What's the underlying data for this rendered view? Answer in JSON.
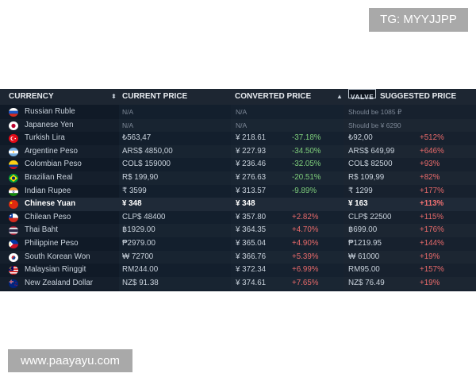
{
  "watermarks": {
    "top": "TG: MYYJJPP",
    "bottom": "www.paayayu.com"
  },
  "header": {
    "currency": "CURRENCY",
    "current_price": "CURRENT PRICE",
    "converted_price": "CONVERTED PRICE",
    "valve_logo": "VALVE",
    "suggested_price": "SUGGESTED PRICE",
    "sort_icon": "updown-arrows-icon",
    "sort_active_icon": "caret-up-icon"
  },
  "colors": {
    "negative": "#7fcf7c",
    "positive": "#e86a6a",
    "background": "#101a27"
  },
  "rows": [
    {
      "currency": "Russian Ruble",
      "flag": "russia-flag-icon",
      "current": "N/A",
      "converted": "N/A",
      "converted_pct": "",
      "suggested": "Should be 1085 ₽",
      "suggested_pct": ""
    },
    {
      "currency": "Japanese Yen",
      "flag": "japan-flag-icon",
      "current": "N/A",
      "converted": "N/A",
      "converted_pct": "",
      "suggested": "Should be ¥ 6290",
      "suggested_pct": ""
    },
    {
      "currency": "Turkish Lira",
      "flag": "turkey-flag-icon",
      "current": "₺563,47",
      "converted": "¥ 218.61",
      "converted_pct": "-37.18%",
      "suggested": "₺92,00",
      "suggested_pct": "+512%"
    },
    {
      "currency": "Argentine Peso",
      "flag": "argentina-flag-icon",
      "current": "ARS$ 4850,00",
      "converted": "¥ 227.93",
      "converted_pct": "-34.50%",
      "suggested": "ARS$ 649,99",
      "suggested_pct": "+646%"
    },
    {
      "currency": "Colombian Peso",
      "flag": "colombia-flag-icon",
      "current": "COL$ 159000",
      "converted": "¥ 236.46",
      "converted_pct": "-32.05%",
      "suggested": "COL$ 82500",
      "suggested_pct": "+93%"
    },
    {
      "currency": "Brazilian Real",
      "flag": "brazil-flag-icon",
      "current": "R$ 199,90",
      "converted": "¥ 276.63",
      "converted_pct": "-20.51%",
      "suggested": "R$ 109,99",
      "suggested_pct": "+82%"
    },
    {
      "currency": "Indian Rupee",
      "flag": "india-flag-icon",
      "current": "₹ 3599",
      "converted": "¥ 313.57",
      "converted_pct": "-9.89%",
      "suggested": "₹ 1299",
      "suggested_pct": "+177%"
    },
    {
      "currency": "Chinese Yuan",
      "flag": "china-flag-icon",
      "current": "¥ 348",
      "converted": "¥ 348",
      "converted_pct": "",
      "suggested": "¥ 163",
      "suggested_pct": "+113%"
    },
    {
      "currency": "Chilean Peso",
      "flag": "chile-flag-icon",
      "current": "CLP$ 48400",
      "converted": "¥ 357.80",
      "converted_pct": "+2.82%",
      "suggested": "CLP$ 22500",
      "suggested_pct": "+115%"
    },
    {
      "currency": "Thai Baht",
      "flag": "thailand-flag-icon",
      "current": "฿1929.00",
      "converted": "¥ 364.35",
      "converted_pct": "+4.70%",
      "suggested": "฿699.00",
      "suggested_pct": "+176%"
    },
    {
      "currency": "Philippine Peso",
      "flag": "philippines-flag-icon",
      "current": "₱2979.00",
      "converted": "¥ 365.04",
      "converted_pct": "+4.90%",
      "suggested": "₱1219.95",
      "suggested_pct": "+144%"
    },
    {
      "currency": "South Korean Won",
      "flag": "south-korea-flag-icon",
      "current": "₩ 72700",
      "converted": "¥ 366.76",
      "converted_pct": "+5.39%",
      "suggested": "₩ 61000",
      "suggested_pct": "+19%"
    },
    {
      "currency": "Malaysian Ringgit",
      "flag": "malaysia-flag-icon",
      "current": "RM244.00",
      "converted": "¥ 372.34",
      "converted_pct": "+6.99%",
      "suggested": "RM95.00",
      "suggested_pct": "+157%"
    },
    {
      "currency": "New Zealand Dollar",
      "flag": "new-zealand-flag-icon",
      "current": "NZ$ 91.38",
      "converted": "¥ 374.61",
      "converted_pct": "+7.65%",
      "suggested": "NZ$ 76.49",
      "suggested_pct": "+19%"
    }
  ]
}
